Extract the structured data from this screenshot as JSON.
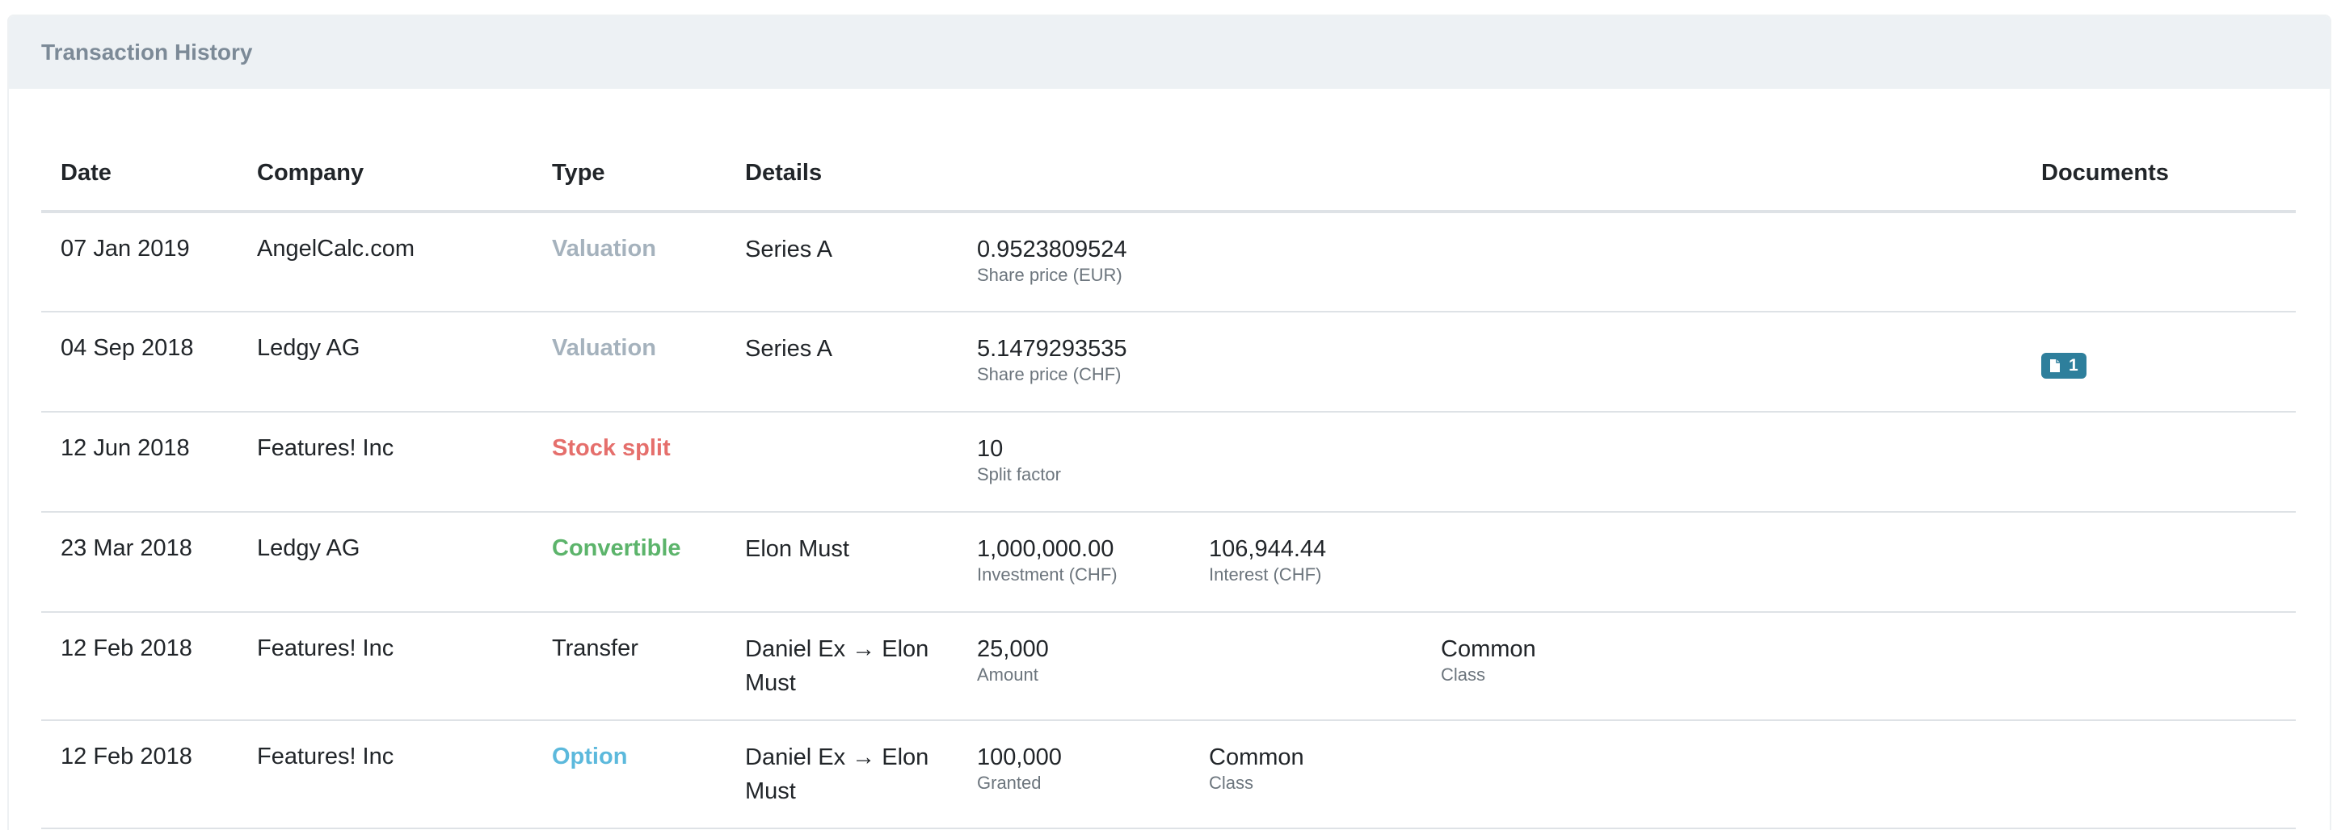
{
  "card": {
    "title": "Transaction History"
  },
  "columns": {
    "date": "Date",
    "company": "Company",
    "type": "Type",
    "details": "Details",
    "documents": "Documents"
  },
  "rows": [
    {
      "date": "07 Jan 2019",
      "company": "AngelCalc.com",
      "type": "Valuation",
      "details": "Series A",
      "v1": "0.9523809524",
      "l1": "Share price (EUR)",
      "v2": "",
      "l2": "",
      "v3": "",
      "l3": "",
      "doc_count": ""
    },
    {
      "date": "04 Sep 2018",
      "company": "Ledgy AG",
      "type": "Valuation",
      "details": "Series A",
      "v1": "5.1479293535",
      "l1": "Share price (CHF)",
      "v2": "",
      "l2": "",
      "v3": "",
      "l3": "",
      "doc_count": "1"
    },
    {
      "date": "12 Jun 2018",
      "company": "Features! Inc",
      "type": "Stock split",
      "details": "",
      "v1": "10",
      "l1": "Split factor",
      "v2": "",
      "l2": "",
      "v3": "",
      "l3": "",
      "doc_count": ""
    },
    {
      "date": "23 Mar 2018",
      "company": "Ledgy AG",
      "type": "Convertible",
      "details": "Elon Must",
      "v1": "1,000,000.00",
      "l1": "Investment (CHF)",
      "v2": "106,944.44",
      "l2": "Interest (CHF)",
      "v3": "",
      "l3": "",
      "doc_count": ""
    },
    {
      "date": "12 Feb 2018",
      "company": "Features! Inc",
      "type": "Transfer",
      "details": "Daniel Ex → Elon Must",
      "v1": "25,000",
      "l1": "Amount",
      "v2": "",
      "l2": "",
      "v3": "Common",
      "l3": "Class",
      "doc_count": ""
    },
    {
      "date": "12 Feb 2018",
      "company": "Features! Inc",
      "type": "Option",
      "details": "Daniel Ex → Elon Must",
      "v1": "100,000",
      "l1": "Granted",
      "v2": "Common",
      "l2": "Class",
      "v3": "",
      "l3": "",
      "doc_count": ""
    }
  ],
  "colors": {
    "valuation": "#a5b2bd",
    "stock_split": "#e56f6c",
    "convertible": "#5cb46b",
    "option": "#5cb9dc",
    "doc_badge": "#2e7f9c"
  },
  "icons": {
    "document": "file-icon"
  }
}
